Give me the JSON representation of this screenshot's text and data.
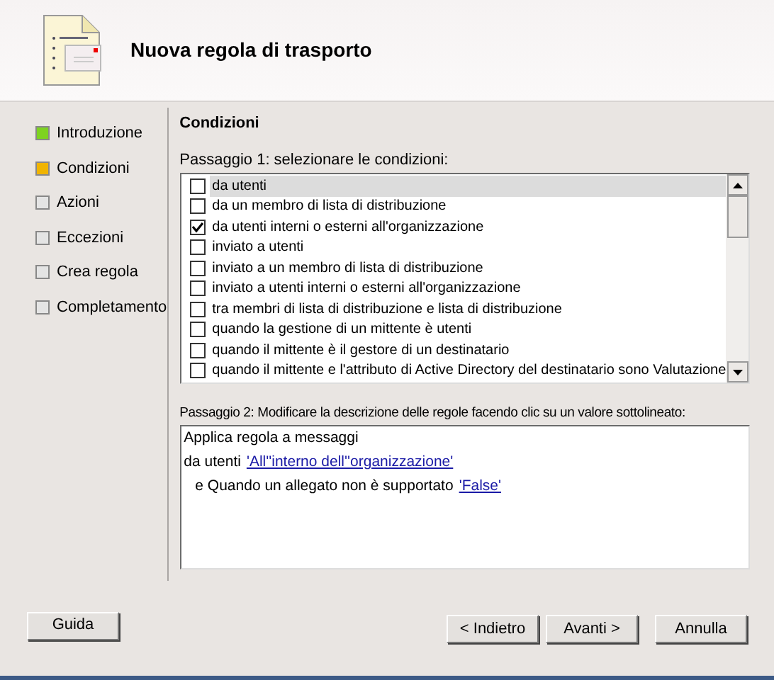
{
  "header": {
    "title": "Nuova regola di trasporto"
  },
  "steps": [
    {
      "label": "Introduzione",
      "color": "#7ed321"
    },
    {
      "label": "Condizioni",
      "color": "#f0b400"
    },
    {
      "label": "Azioni",
      "color": "#e4e4e4"
    },
    {
      "label": "Eccezioni",
      "color": "#e4e4e4"
    },
    {
      "label": "Crea regola",
      "color": "#e4e4e4"
    },
    {
      "label": "Completamento",
      "color": "#e4e4e4"
    }
  ],
  "section_title": "Condizioni",
  "step1_label": "Passaggio 1: selezionare le condizioni:",
  "conditions": [
    {
      "label": "da utenti",
      "checked": false,
      "selected": true
    },
    {
      "label": "da un membro di lista di distribuzione",
      "checked": false,
      "selected": false
    },
    {
      "label": "da utenti interni o esterni all'organizzazione",
      "checked": true,
      "selected": false
    },
    {
      "label": "inviato a utenti",
      "checked": false,
      "selected": false
    },
    {
      "label": "inviato a un membro di lista di distribuzione",
      "checked": false,
      "selected": false
    },
    {
      "label": "inviato a utenti interni o esterni all'organizzazione",
      "checked": false,
      "selected": false
    },
    {
      "label": "tra membri di lista di distribuzione e lista di distribuzione",
      "checked": false,
      "selected": false
    },
    {
      "label": "quando la gestione di un mittente è utenti",
      "checked": false,
      "selected": false
    },
    {
      "label": "quando il mittente è il gestore di un destinatario",
      "checked": false,
      "selected": false
    },
    {
      "label": "quando il mittente e l'attributo di Active Directory del destinatario sono Valutazione",
      "checked": false,
      "selected": false
    }
  ],
  "step2_label": "Passaggio 2: Modificare la descrizione delle regole facendo clic su un valore sottolineato:",
  "description": [
    {
      "text": "Applica regola a messaggi"
    },
    {
      "text": "da utenti",
      "link": "'All''interno dell''organizzazione'",
      "children": [
        {
          "text": "e Quando un allegato non è supportato",
          "link": "'False'"
        }
      ]
    }
  ],
  "buttons": {
    "help": "Guida",
    "back": "< Indietro",
    "next": "Avanti >",
    "cancel": "Annulla"
  }
}
